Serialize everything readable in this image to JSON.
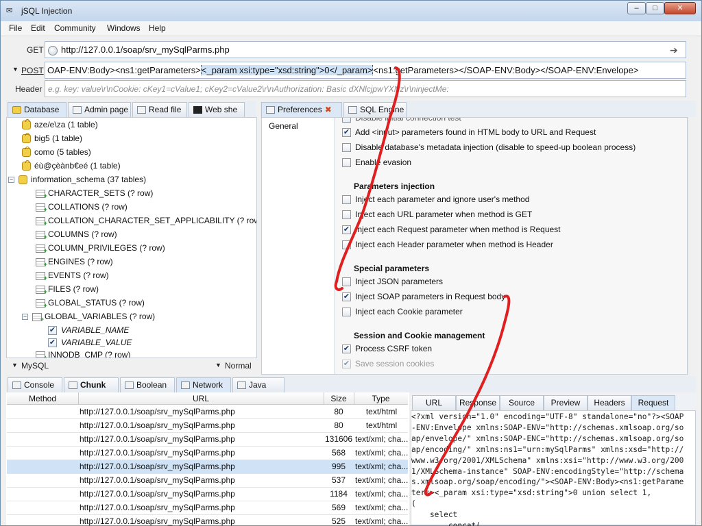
{
  "window": {
    "title": "jSQL Injection"
  },
  "menu": [
    "File",
    "Edit",
    "Community",
    "Windows",
    "Help"
  ],
  "request": {
    "get_label": "GET",
    "url": "http://127.0.0.1/soap/srv_mySqlParms.php",
    "post_label": "POST",
    "post_before": "OAP-ENV:Body><ns1:getParameters>",
    "post_selected": "<_param xsi:type=\"xsd:string\">0</_param>",
    "post_after": "<ns1:getParameters></SOAP-ENV:Body></SOAP-ENV:Envelope>",
    "header_label": "Header",
    "header_placeholder": "e.g. key: value\\r\\nCookie: cKey1=cValue1; cKey2=cValue2\\r\\nAuthorization: Basic dXNlcjpwYXNz\\r\\ninjectMe:"
  },
  "left_tabs": [
    "Database",
    "Admin page",
    "Read file",
    "Web she"
  ],
  "tree": {
    "databases": [
      "aze/e\\za (1 table)",
      "big5 (1 table)",
      "como (5 tables)",
      "éù@çèànb€eé (1 table)",
      "information_schema (37 tables)"
    ],
    "tables": [
      "CHARACTER_SETS (? row)",
      "COLLATIONS (? row)",
      "COLLATION_CHARACTER_SET_APPLICABILITY (? row)",
      "COLUMNS (? row)",
      "COLUMN_PRIVILEGES (? row)",
      "ENGINES (? row)",
      "EVENTS (? row)",
      "FILES (? row)",
      "GLOBAL_STATUS (? row)",
      "GLOBAL_VARIABLES (? row)"
    ],
    "columns": [
      "VARIABLE_NAME",
      "VARIABLE_VALUE"
    ],
    "partial": "INNODB_CMP (? row)",
    "engine": "MySQL",
    "strategy": "Normal"
  },
  "right_tabs": [
    "Preferences",
    "SQL Engine"
  ],
  "prefs_category": "General",
  "prefs": {
    "top_cut": "Disable initial connection test",
    "general": [
      {
        "label": "Add <input> parameters found in HTML body to URL and Request",
        "checked": true
      },
      {
        "label": "Disable database's metadata injection (disable to speed-up boolean process)",
        "checked": false
      },
      {
        "label": "Enable evasion",
        "checked": false
      }
    ],
    "injection_title": "Parameters injection",
    "injection": [
      {
        "label": "Inject each parameter and ignore user's method",
        "checked": false
      },
      {
        "label": "Inject each URL parameter when method is GET",
        "checked": false
      },
      {
        "label": "Inject each Request parameter when method is Request",
        "checked": true
      },
      {
        "label": "Inject each Header parameter when method is Header",
        "checked": false
      }
    ],
    "special_title": "Special parameters",
    "special": [
      {
        "label": "Inject JSON parameters",
        "checked": false
      },
      {
        "label": "Inject SOAP parameters in Request body",
        "checked": true
      },
      {
        "label": "Inject each Cookie parameter",
        "checked": false
      }
    ],
    "session_title": "Session and Cookie management",
    "session": [
      {
        "label": "Process CSRF token",
        "checked": true
      },
      {
        "label": "Save session cookies",
        "checked": true,
        "disabled": true
      }
    ]
  },
  "bottom_tabs": [
    "Console",
    "Chunk",
    "Boolean",
    "Network",
    "Java"
  ],
  "network": {
    "headers": [
      "Method",
      "URL",
      "Size",
      "Type"
    ],
    "rows": [
      {
        "url": "http://127.0.0.1/soap/srv_mySqlParms.php",
        "size": "80",
        "type": "text/html"
      },
      {
        "url": "http://127.0.0.1/soap/srv_mySqlParms.php",
        "size": "80",
        "type": "text/html"
      },
      {
        "url": "http://127.0.0.1/soap/srv_mySqlParms.php",
        "size": "131606",
        "type": "text/xml; cha..."
      },
      {
        "url": "http://127.0.0.1/soap/srv_mySqlParms.php",
        "size": "568",
        "type": "text/xml; cha..."
      },
      {
        "url": "http://127.0.0.1/soap/srv_mySqlParms.php",
        "size": "995",
        "type": "text/xml; cha..."
      },
      {
        "url": "http://127.0.0.1/soap/srv_mySqlParms.php",
        "size": "537",
        "type": "text/xml; cha..."
      },
      {
        "url": "http://127.0.0.1/soap/srv_mySqlParms.php",
        "size": "1184",
        "type": "text/xml; cha..."
      },
      {
        "url": "http://127.0.0.1/soap/srv_mySqlParms.php",
        "size": "569",
        "type": "text/xml; cha..."
      },
      {
        "url": "http://127.0.0.1/soap/srv_mySqlParms.php",
        "size": "525",
        "type": "text/xml; cha..."
      }
    ],
    "detail_tabs": [
      "URL",
      "Response",
      "Source",
      "Preview",
      "Headers",
      "Request"
    ],
    "request_lines": [
      "<?xml version=\"1.0\" encoding=\"UTF-8\" standalone=\"no\"?><SOAP",
      "-ENV:Envelope xmlns:SOAP-ENV=\"http://schemas.xmlsoap.org/so",
      "ap/envelope/\" xmlns:SOAP-ENC=\"http://schemas.xmlsoap.org/so",
      "ap/encoding/\" xmlns:ns1=\"urn:mySqlParms\" xmlns:xsd=\"http://",
      "www.w3.org/2001/XMLSchema\" xmlns:xsi=\"http://www.w3.org/200",
      "1/XMLSchema-instance\" SOAP-ENV:encodingStyle=\"http://schema",
      "s.xmlsoap.org/soap/encoding/\"><SOAP-ENV:Body><ns1:getParame",
      "ters><_param xsi:type=\"xsd:string\">0 union select 1,",
      "(",
      "    select",
      "        concat("
    ]
  },
  "colors": {
    "annotation": "#e02020",
    "selection": "#cfe2f6"
  }
}
